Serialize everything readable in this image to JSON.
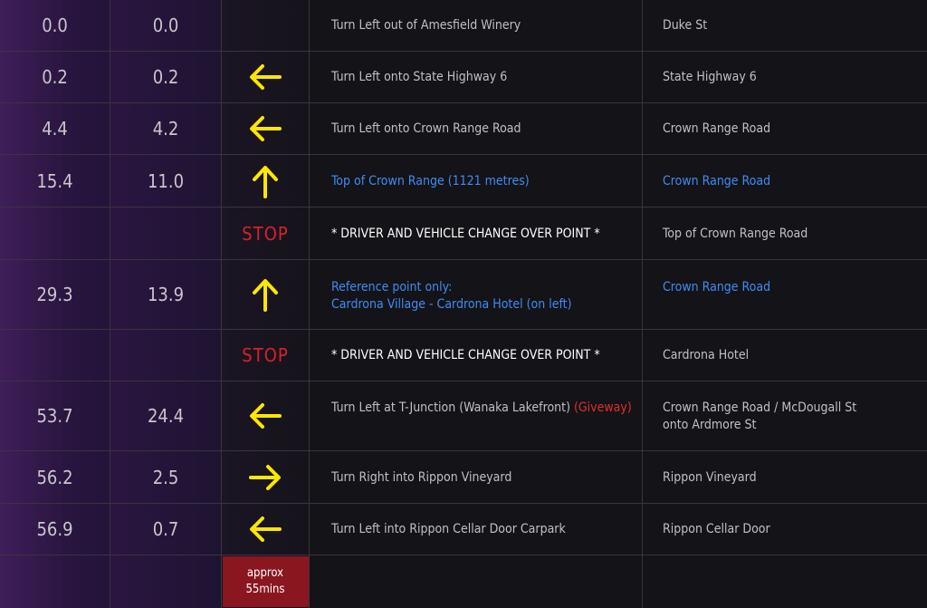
{
  "colors": {
    "arrow": "#ffe600",
    "stop": "#d8222a",
    "highlight": "#3d8df5",
    "badge_bg": "#8a1620"
  },
  "rows": [
    {
      "total": "0.0",
      "leg": "0.0",
      "icon": "none",
      "instruction": "Turn Left out of Amesfield Winery",
      "road": "Duke St"
    },
    {
      "total": "0.2",
      "leg": "0.2",
      "icon": "arrow-left-icon",
      "instruction": "Turn Left onto State Highway 6",
      "road": "State Highway 6"
    },
    {
      "total": "4.4",
      "leg": "4.2",
      "icon": "arrow-left-icon",
      "instruction": "Turn Left onto Crown Range Road",
      "road": "Crown Range Road"
    },
    {
      "total": "15.4",
      "leg": "11.0",
      "icon": "arrow-up-icon",
      "instruction": "Top of Crown Range (1121 metres)",
      "road": "Crown Range Road"
    },
    {
      "total": "",
      "leg": "",
      "icon": "stop",
      "stop_label": "STOP",
      "instruction": "* DRIVER AND VEHICLE CHANGE OVER POINT *",
      "road": "Top of Crown Range Road"
    },
    {
      "total": "29.3",
      "leg": "13.9",
      "icon": "arrow-up-icon",
      "instruction_line1": "Reference point only:",
      "instruction_line2": "Cardrona Village - Cardrona Hotel (on left)",
      "road": "Crown Range Road"
    },
    {
      "total": "",
      "leg": "",
      "icon": "stop",
      "stop_label": "STOP",
      "instruction": "* DRIVER AND VEHICLE CHANGE OVER POINT *",
      "road": "Cardrona Hotel"
    },
    {
      "total": "53.7",
      "leg": "24.4",
      "icon": "arrow-left-icon",
      "instruction": "Turn Left at T-Junction (Wanaka Lakefront)",
      "instruction_note": "(Giveway)",
      "road_line1": "Crown Range Road / McDougall St",
      "road_line2": "onto Ardmore St"
    },
    {
      "total": "56.2",
      "leg": "2.5",
      "icon": "arrow-right-icon",
      "instruction": "Turn Right into Rippon Vineyard",
      "road": "Rippon Vineyard"
    },
    {
      "total": "56.9",
      "leg": "0.7",
      "icon": "arrow-left-icon",
      "instruction": "Turn Left into Rippon Cellar Door Carpark",
      "road": "Rippon Cellar Door"
    }
  ],
  "footer": {
    "badge_line1": "approx",
    "badge_line2": "55mins"
  }
}
